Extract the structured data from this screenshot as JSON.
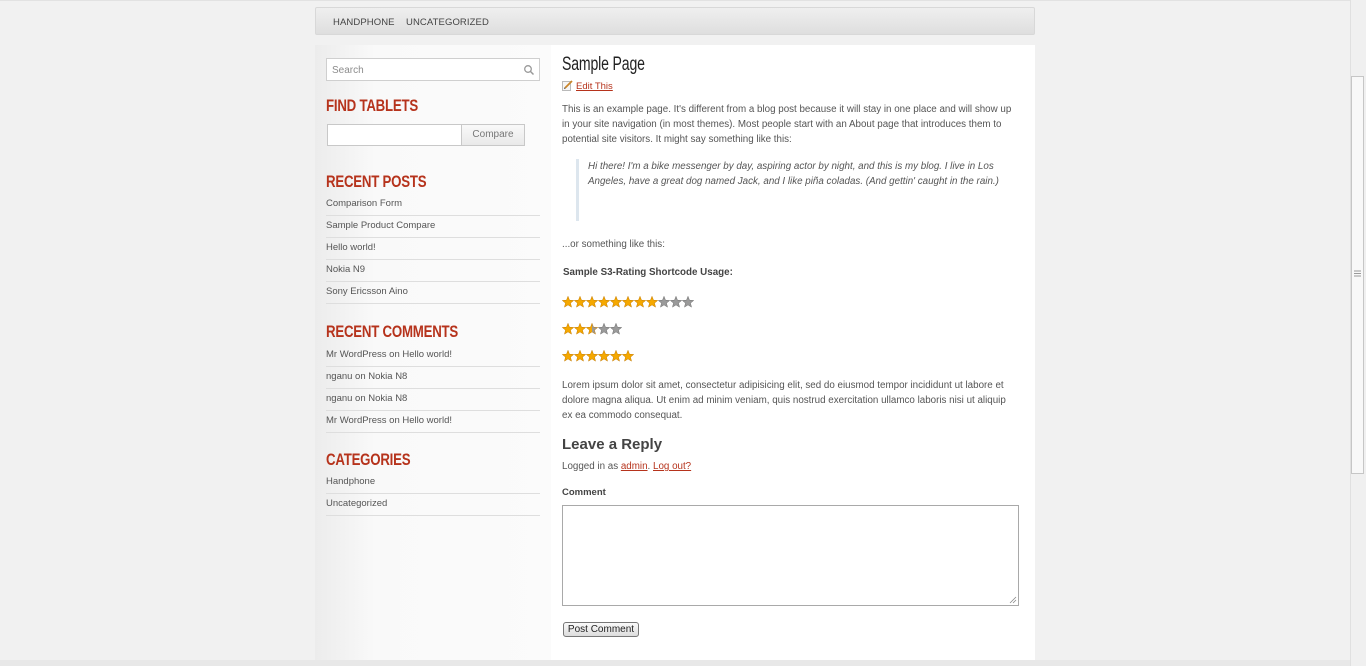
{
  "nav": {
    "items": [
      "HANDPHONE",
      "UNCATEGORIZED"
    ]
  },
  "sidebar": {
    "search_placeholder": "Search",
    "find_tablets": {
      "title": "FIND TABLETS",
      "compare_label": "Compare"
    },
    "recent_posts": {
      "title": "RECENT POSTS",
      "items": [
        "Comparison Form",
        "Sample Product Compare",
        "Hello world!",
        "Nokia N9",
        "Sony Ericsson Aino"
      ]
    },
    "recent_comments": {
      "title": "RECENT COMMENTS",
      "items": [
        "Mr WordPress on Hello world!",
        "nganu on Nokia N8",
        "nganu on Nokia N8",
        "Mr WordPress on Hello world!"
      ]
    },
    "categories": {
      "title": "CATEGORIES",
      "items": [
        "Handphone",
        "Uncategorized"
      ]
    }
  },
  "page": {
    "title": "Sample Page",
    "edit_label": "Edit This",
    "intro": "This is an example page. It's different from a blog post because it will stay in one place and will show up in your site navigation (in most themes). Most people start with an About page that introduces them to potential site visitors. It might say something like this:",
    "quote": "Hi there! I'm a bike messenger by day, aspiring actor by night, and this is my blog. I live in Los Angeles, have a great dog named Jack, and I like piña coladas. (And gettin' caught in the rain.)",
    "or_text": "...or something like this:",
    "ratings_heading": "Sample S3-Rating Shortcode Usage:",
    "ratings": [
      {
        "value": 8,
        "max": 11
      },
      {
        "value": 2.5,
        "max": 5
      },
      {
        "value": 6,
        "max": 6
      }
    ],
    "lorem": "Lorem ipsum dolor sit amet, consectetur adipisicing elit, sed do eiusmod tempor incididunt ut labore et dolore magna aliqua. Ut enim ad minim veniam, quis nostrud exercitation ullamco laboris nisi ut aliquip ex ea commodo consequat."
  },
  "reply": {
    "heading": "Leave a Reply",
    "logged_prefix": "Logged in as",
    "user": "admin",
    "sep": ".",
    "logout": "Log out?",
    "comment_label": "Comment",
    "post_label": "Post Comment"
  },
  "colors": {
    "accent": "#b6331c",
    "star_on": "#f5a800",
    "star_off": "#9a9a9a"
  }
}
